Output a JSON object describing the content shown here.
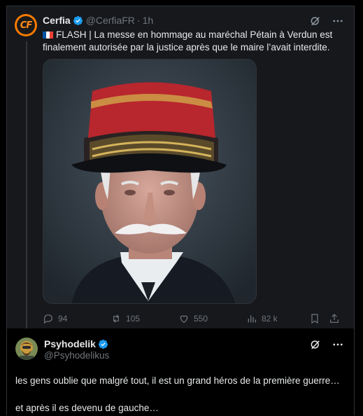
{
  "tweet1": {
    "author_name": "Cerfia",
    "handle": "@CerfiaFR",
    "separator": "·",
    "time": "1h",
    "avatar_text": "CF",
    "text": "FLASH | La messe en hommage au maréchal Pétain à Verdun est finalement autorisée par la justice après que le maire l’avait interdite.",
    "stats": {
      "replies": "94",
      "reposts": "105",
      "likes": "550",
      "views": "82 k"
    }
  },
  "tweet2": {
    "author_name": "Psyhodelik",
    "handle": "@Psyhodelikus",
    "lines": [
      "les gens oublie que malgré tout, il est un grand héros de la première guerre…",
      "et après il es devenu de gauche…"
    ]
  },
  "colors": {
    "background": "#000000",
    "card": "#16181c",
    "text": "#e7e9ea",
    "muted": "#71767b",
    "verified": "#1d9bf0",
    "avatar_orange": "#f97a00"
  },
  "icons": [
    "verified-badge-icon",
    "grok-icon",
    "more-icon",
    "reply-icon",
    "repost-icon",
    "like-icon",
    "views-icon",
    "bookmark-icon",
    "share-icon",
    "france-flag-icon"
  ]
}
